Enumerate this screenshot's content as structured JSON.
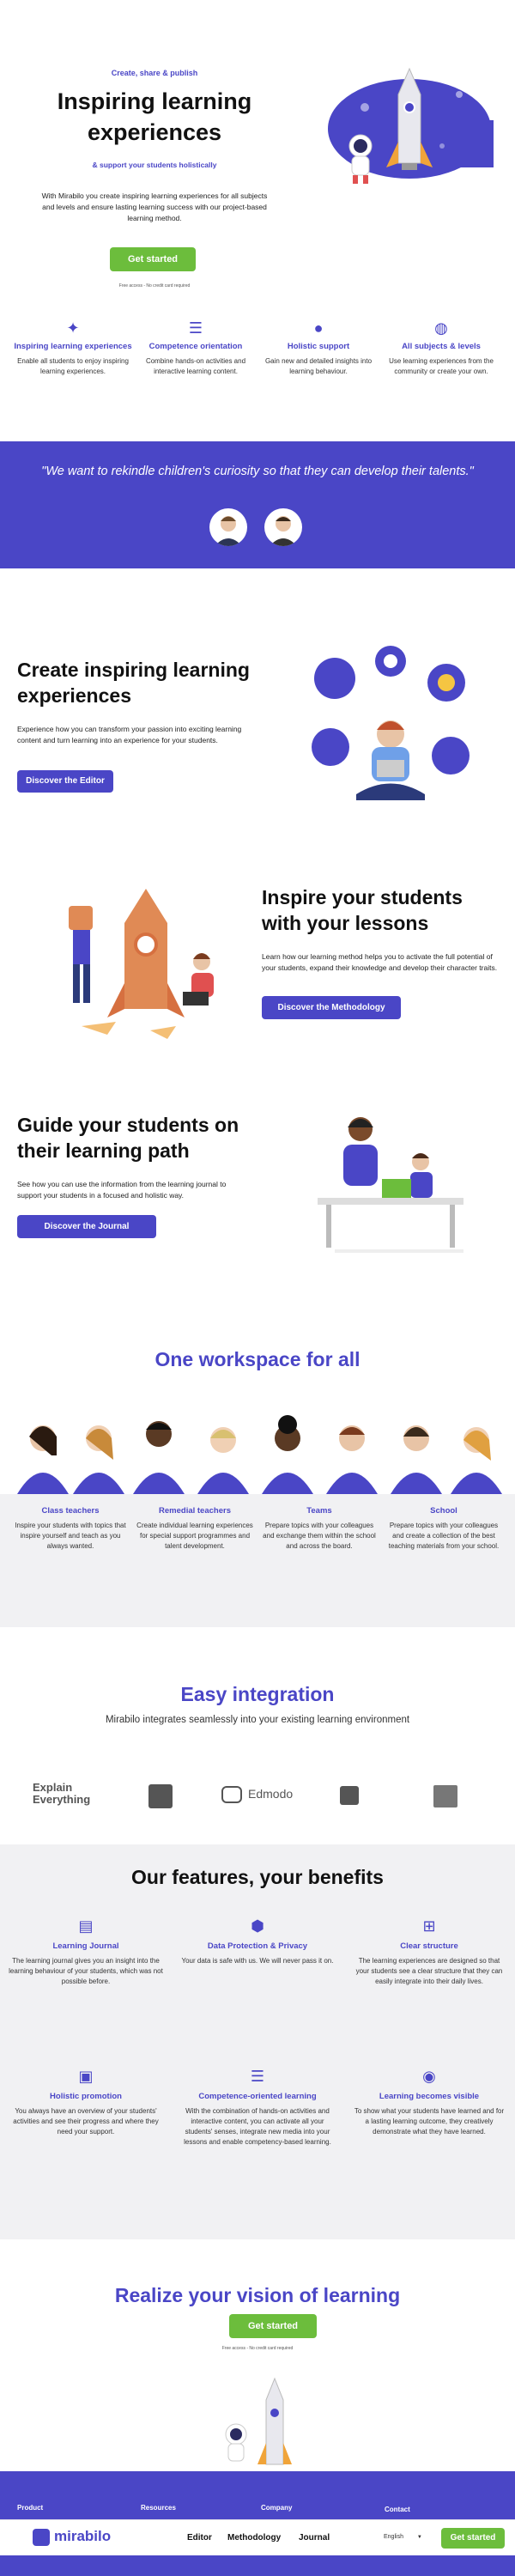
{
  "hero": {
    "eyebrow": "Create, share & publish",
    "title_line1": "Inspiring learning",
    "title_line2": "experiences",
    "subtitle": "& support your students holistically",
    "description": "With Mirabilo you create inspiring learning experiences for all subjects and levels and ensure lasting learning success with our project-based learning method.",
    "cta": "Get started",
    "note": "Free access - No credit card required"
  },
  "benefits": [
    {
      "icon": "sparkle-icon",
      "title": "Inspiring learning experiences",
      "desc": "Enable all students to enjoy inspiring learning experiences."
    },
    {
      "icon": "list-icon",
      "title": "Competence orientation",
      "desc": "Combine hands-on activities and interactive learning content."
    },
    {
      "icon": "person-icon",
      "title": "Holistic support",
      "desc": "Gain new and detailed insights into learning behaviour."
    },
    {
      "icon": "globe-icon",
      "title": "All subjects & levels",
      "desc": "Use learning experiences from the community or create your own."
    }
  ],
  "quote": {
    "text": "\"We want to rekindle children's curiosity so that they can develop their talents.\""
  },
  "editor": {
    "title_line1": "Create inspiring learning",
    "title_line2": "experiences",
    "desc": "Experience how you can transform your passion into exciting learning content and turn learning into an experience for your students.",
    "cta": "Discover the Editor"
  },
  "method": {
    "title_line1": "Inspire your students",
    "title_line2": "with your lessons",
    "desc": "Learn how our learning method helps you to activate the full potential of your students, expand their knowledge and develop their character traits.",
    "cta": "Discover the Methodology"
  },
  "journal": {
    "title_line1": "Guide your students on",
    "title_line2": "their learning path",
    "desc": "See how you can use the information from the learning journal to support your students in a focused and holistic way.",
    "cta": "Discover the Journal"
  },
  "workspace": {
    "title": "One workspace for all",
    "groups": [
      {
        "title": "Class teachers",
        "desc": "Inspire your students with topics that inspire yourself and teach as you always wanted."
      },
      {
        "title": "Remedial teachers",
        "desc": "Create individual learning experiences for special support programmes and talent development."
      },
      {
        "title": "Teams",
        "desc": "Prepare topics with your colleagues and exchange them within the school and across the board."
      },
      {
        "title": "School",
        "desc": "Prepare topics with your colleagues and create a collection of the best teaching materials from your school."
      }
    ]
  },
  "integration": {
    "title": "Easy integration",
    "subtitle": "Mirabilo integrates seamlessly into your existing learning environment",
    "logos": [
      "Explain Everything",
      "Edmodo"
    ]
  },
  "features": {
    "title": "Our features, your benefits",
    "items": [
      {
        "icon": "journal-icon",
        "title": "Learning Journal",
        "desc": "The learning journal gives you an insight into the learning behaviour of your students, which was not possible before."
      },
      {
        "icon": "shield-check-icon",
        "title": "Data Protection & Privacy",
        "desc": "Your data is safe with us. We will never pass it on."
      },
      {
        "icon": "structure-icon",
        "title": "Clear structure",
        "desc": "The learning experiences are designed so that your students see a clear structure that they can easily integrate into their daily lives."
      },
      {
        "icon": "badge-icon",
        "title": "Holistic promotion",
        "desc": "You always have an overview of your students' activities and see their progress and where they need your support."
      },
      {
        "icon": "list-icon",
        "title": "Competence-oriented learning",
        "desc": "With the combination of hands-on activities and interactive content, you can activate all your students' senses, integrate new media into your lessons and enable competency-based learning."
      },
      {
        "icon": "eye-icon",
        "title": "Learning becomes visible",
        "desc": "To show what your students have learned and for a lasting learning outcome, they creatively demonstrate what they have learned."
      }
    ]
  },
  "realize": {
    "title": "Realize your vision of learning",
    "cta": "Get started",
    "note": "Free access - No credit card required"
  },
  "footer": {
    "columns": [
      "Product",
      "Resources",
      "Company",
      "Contact"
    ]
  },
  "bottom_nav": {
    "brand": "mirabilo",
    "links": [
      "Editor",
      "Methodology",
      "Journal"
    ],
    "language": "English",
    "cta": "Get started"
  },
  "colors": {
    "brand": "#4a46c6",
    "cta": "#6cbd3c"
  }
}
